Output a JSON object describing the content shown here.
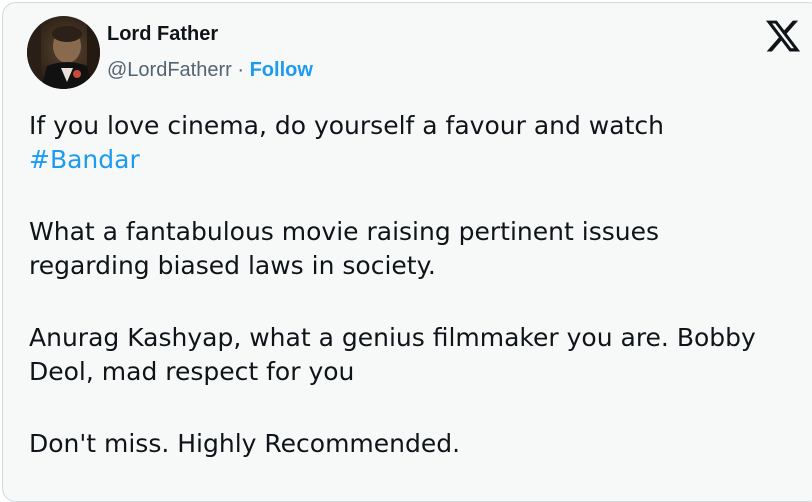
{
  "author": {
    "name": "Lord Father",
    "handle": "@LordFatherr",
    "separator": "·",
    "follow_label": "Follow"
  },
  "header": {
    "logo_icon": "x-logo-icon"
  },
  "tweet": {
    "line1": "If you love cinema, do yourself a favour and watch",
    "hashtag": "#Bandar",
    "line2a": "What a fantabulous movie raising pertinent issues",
    "line2b": "regarding biased laws in society.",
    "line3a": "Anurag Kashyap, what a genius filmmaker you are. Bobby",
    "line3b": "Deol, mad respect for you",
    "line4": "Don't miss. Highly Recommended."
  },
  "colors": {
    "link": "#1d9bf0",
    "text": "#0f1419",
    "secondary": "#536471",
    "card_bg": "#f7f9f9",
    "border": "#cfd9de"
  }
}
